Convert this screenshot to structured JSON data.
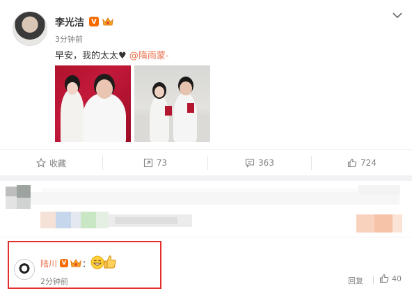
{
  "post": {
    "author": "李光洁",
    "verified_badge": "V",
    "time": "3分钟前",
    "text_prefix": "早安，我的太太",
    "heart": "♥",
    "mention": "@隋雨蒙-",
    "photos": [
      "wedding-photo-red",
      "couple-with-certificates"
    ]
  },
  "actions": {
    "favorite_label": "收藏",
    "repost_count": "73",
    "comment_count": "363",
    "like_count": "724"
  },
  "comment": {
    "author": "陆川",
    "verified_badge": "V",
    "colon": "：",
    "time": "2分钟前",
    "reply_label": "回复",
    "like_count": "40"
  },
  "colors": {
    "accent": "#eb7350",
    "badge": "#f76a00",
    "highlight_box": "#e32c2c"
  },
  "icons": [
    "chevron-down-icon",
    "star-icon",
    "repost-icon",
    "comment-icon",
    "thumbs-up-icon",
    "crown-icon",
    "laughing-emoji-icon",
    "thumbs-up-emoji-icon"
  ]
}
